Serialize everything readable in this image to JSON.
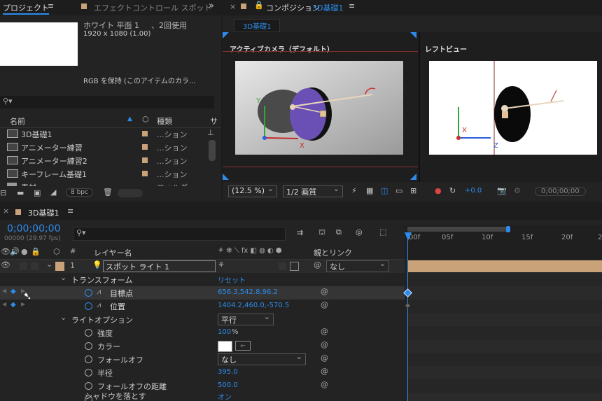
{
  "project_panel": {
    "tab": "プロジェクト",
    "effect_tab": "エフェクトコントロール スポット",
    "item_name": "ホワイト 平面 1",
    "usage": "、2回使用",
    "dimensions": "1920 x 1080 (1.00)",
    "alpha_note": "RGB を保持 (このアイテムのカラ...",
    "search_placeholder": "",
    "col_name": "名前",
    "col_type": "種類",
    "col_extra": "サ",
    "items": [
      {
        "name": "3D基礎1",
        "type": "...ション"
      },
      {
        "name": "アニメーター練習",
        "type": "...ション"
      },
      {
        "name": "アニメーター練習2",
        "type": "...ション"
      },
      {
        "name": "キーフレーム基礎1",
        "type": "...ション"
      },
      {
        "name": "素材",
        "type": "フォルダー"
      }
    ],
    "bpc": "8 bpc"
  },
  "comp_panel": {
    "tab": "コンポジション",
    "comp_name": "3D基礎1",
    "sub_tab": "3D基礎1",
    "view_left_label": "アクティブカメラ（デフォルト）",
    "view_right_label": "レフトビュー",
    "zoom": "(12.5 %)",
    "resolution": "1/2 画質",
    "exposure": "+0.0",
    "timecode": "0;00;00;00",
    "axis_x": "X",
    "axis_y": "Y",
    "axis_z": "Z"
  },
  "timeline": {
    "tab": "3D基礎1",
    "timecode": "0;00;00;00",
    "fps": "00000 (29.97 fps)",
    "search_placeholder": "",
    "col_num": "#",
    "col_layer": "レイヤー名",
    "col_parent": "親とリンク",
    "layer": {
      "num": "1",
      "name": "スポット ライト 1",
      "parent": "なし"
    },
    "transform": {
      "label": "トランスフォーム",
      "reset": "リセット"
    },
    "props": [
      {
        "label": "目標点",
        "value": "656.3,542.8,96.2"
      },
      {
        "label": "位置",
        "value": "1404.2,460.0,-570.5"
      }
    ],
    "light_options": {
      "label": "ライトオプション",
      "type": "平行"
    },
    "light_props": [
      {
        "label": "強度",
        "value": "100",
        "unit": "%"
      },
      {
        "label": "カラー",
        "value": ""
      },
      {
        "label": "フォールオフ",
        "value": "なし"
      },
      {
        "label": "半径",
        "value": "395.0"
      },
      {
        "label": "フォールオフの距離",
        "value": "500.0"
      },
      {
        "label": "シャドウを落とす",
        "value": "オン"
      }
    ],
    "ruler": [
      "00f",
      "05f",
      "10f",
      "15f",
      "20f",
      "2"
    ]
  },
  "colors": {
    "accent": "#2d8ceb",
    "label_tan": "#c9a27a",
    "track_tan": "#c9a27a",
    "purple": "#6b4fb0"
  }
}
